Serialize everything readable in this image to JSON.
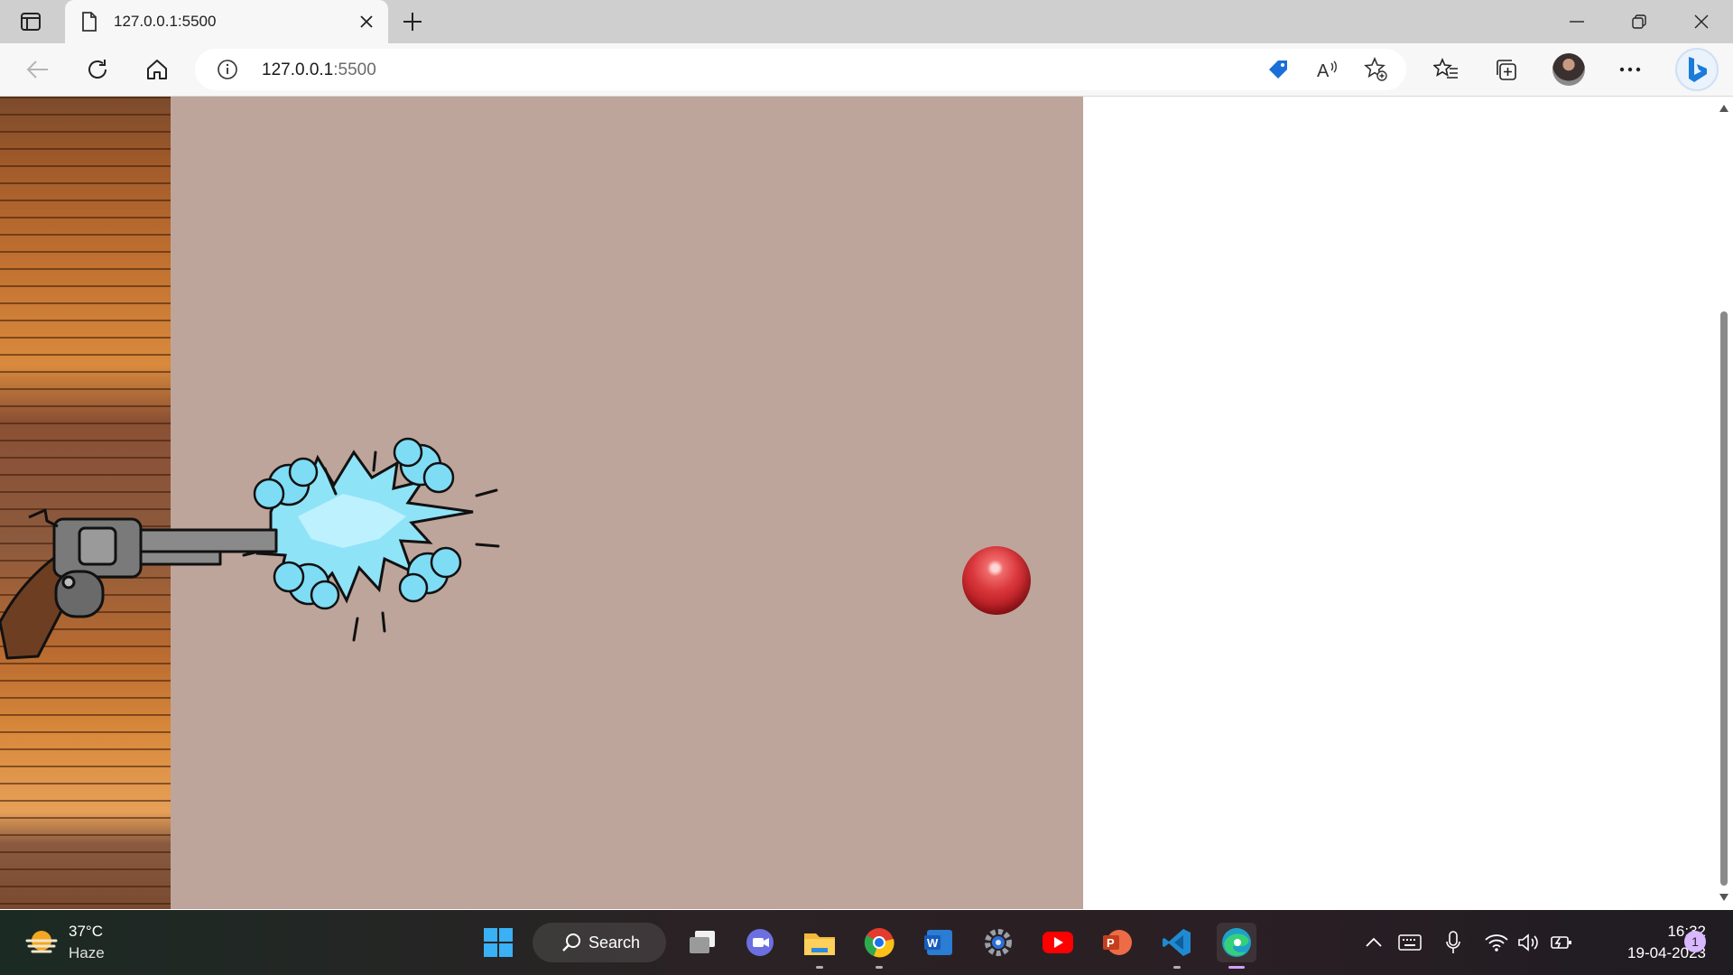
{
  "browser": {
    "tab": {
      "title": "127.0.0.1:5500"
    },
    "address": {
      "host": "127.0.0.1",
      "port": ":5500"
    }
  },
  "taskbar": {
    "weather": {
      "temperature": "37°C",
      "condition": "Haze"
    },
    "search_label": "Search",
    "clock": {
      "time": "16:32",
      "date": "19-04-2023"
    },
    "notification_count": "1",
    "apps": [
      "start",
      "search",
      "task-view",
      "teams",
      "file-explorer",
      "chrome",
      "word",
      "settings",
      "youtube",
      "powerpoint",
      "vscode",
      "edge"
    ]
  },
  "colors": {
    "game_background": "#bda59b",
    "ball": "#d8363a",
    "smoke": "#7fdcf5",
    "taskbar": "#2a2224"
  }
}
